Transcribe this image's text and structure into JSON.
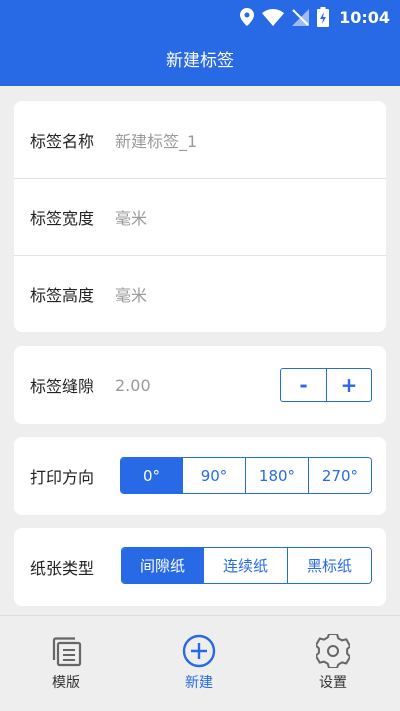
{
  "status_bar": {
    "time": "10:04",
    "icons": [
      "location-icon",
      "wifi-icon",
      "no-signal-icon",
      "battery-charging-icon"
    ]
  },
  "header": {
    "title": "新建标签"
  },
  "form": {
    "name": {
      "label": "标签名称",
      "placeholder": "新建标签_1"
    },
    "width": {
      "label": "标签宽度",
      "placeholder": "毫米"
    },
    "height": {
      "label": "标签高度",
      "placeholder": "毫米"
    },
    "gap": {
      "label": "标签缝隙",
      "value": "2.00",
      "minus": "-",
      "plus": "+"
    },
    "direction": {
      "label": "打印方向",
      "options": [
        "0°",
        "90°",
        "180°",
        "270°"
      ],
      "selected": "0°"
    },
    "paper": {
      "label": "纸张类型",
      "options": [
        "间隙纸",
        "连续纸",
        "黑标纸"
      ],
      "selected": "间隙纸"
    }
  },
  "bottom_nav": {
    "items": [
      {
        "label": "模版",
        "icon": "template-icon",
        "active": false
      },
      {
        "label": "新建",
        "icon": "add-circle-icon",
        "active": true
      },
      {
        "label": "设置",
        "icon": "gear-icon",
        "active": false
      }
    ]
  },
  "colors": {
    "primary": "#2869e6",
    "background": "#eeeeee",
    "placeholder": "#9a9a9a"
  }
}
